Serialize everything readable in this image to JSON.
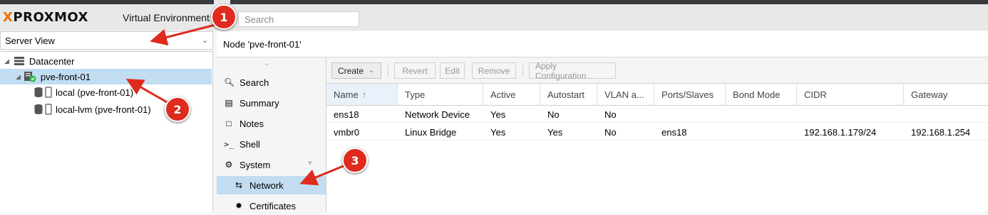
{
  "header": {
    "logo_prefix": "X",
    "logo_text": "PROXMOX",
    "subtitle": "Virtual Environment",
    "search_placeholder": "Search"
  },
  "view_selector": {
    "value": "Server View"
  },
  "tree": {
    "items": [
      {
        "label": "Datacenter",
        "icon": "datacenter-icon",
        "selected": false
      },
      {
        "label": "pve-front-01",
        "icon": "server-online-icon",
        "selected": true
      },
      {
        "label": "local (pve-front-01)",
        "icon": "storage-icon",
        "selected": false
      },
      {
        "label": "local-lvm (pve-front-01)",
        "icon": "storage-icon",
        "selected": false
      }
    ]
  },
  "node_title": "Node 'pve-front-01'",
  "nav": {
    "items": [
      {
        "label": "Search",
        "icon": "search-icon"
      },
      {
        "label": "Summary",
        "icon": "book-icon"
      },
      {
        "label": "Notes",
        "icon": "notes-icon"
      },
      {
        "label": "Shell",
        "icon": "terminal-icon"
      },
      {
        "label": "System",
        "icon": "gears-icon"
      },
      {
        "label": "Network",
        "icon": "exchange-icon",
        "selected": true
      },
      {
        "label": "Certificates",
        "icon": "certificate-icon"
      }
    ]
  },
  "toolbar": {
    "create": "Create",
    "revert": "Revert",
    "edit": "Edit",
    "remove": "Remove",
    "apply": "Apply Configuration"
  },
  "grid": {
    "columns": [
      "Name",
      "Type",
      "Active",
      "Autostart",
      "VLAN a...",
      "Ports/Slaves",
      "Bond Mode",
      "CIDR",
      "Gateway"
    ],
    "sorted_column": "Name",
    "rows": [
      [
        "ens18",
        "Network Device",
        "Yes",
        "No",
        "No",
        "",
        "",
        "",
        ""
      ],
      [
        "vmbr0",
        "Linux Bridge",
        "Yes",
        "Yes",
        "No",
        "ens18",
        "",
        "192.168.1.179/24",
        "192.168.1.254"
      ]
    ]
  },
  "markers": [
    "1",
    "2",
    "3"
  ],
  "colors": {
    "marker": "#de2b1d",
    "selection": "#c2ddf2",
    "logo_accent": "#e57000"
  }
}
